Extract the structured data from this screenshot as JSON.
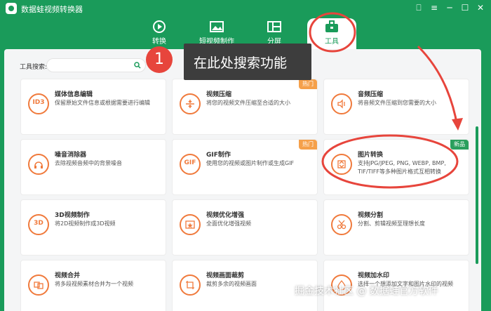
{
  "app": {
    "title": "数据蛙视频转换器"
  },
  "window_controls": {
    "feedback": "⎕",
    "menu": "≡",
    "minimize": "─",
    "maximize": "☐",
    "close": "✕"
  },
  "nav": [
    {
      "label": "转换",
      "icon": "convert-icon"
    },
    {
      "label": "短视频制作",
      "icon": "video-maker-icon"
    },
    {
      "label": "分屏",
      "icon": "split-screen-icon"
    },
    {
      "label": "工具",
      "icon": "toolbox-icon",
      "active": true
    }
  ],
  "search": {
    "label": "工具搜索:",
    "value": "",
    "placeholder": ""
  },
  "tools": [
    {
      "title": "媒体信息编辑",
      "desc": "保留原始文件信息或根据需要进行编辑",
      "icon_text": "ID3",
      "badge": ""
    },
    {
      "title": "视频压缩",
      "desc": "将您的视频文件压缩至合适的大小",
      "icon_text": "",
      "badge": "热门"
    },
    {
      "title": "音频压缩",
      "desc": "将音频文件压缩到您需要的大小",
      "icon_text": "",
      "badge": ""
    },
    {
      "title": "噪音消除器",
      "desc": "去除视频音频中的背景噪音",
      "icon_text": "",
      "badge": ""
    },
    {
      "title": "GIF制作",
      "desc": "使用您的视频或图片制作或生成GIF",
      "icon_text": "GIF",
      "badge": "热门"
    },
    {
      "title": "图片转换",
      "desc": "支持JPG/JPEG, PNG, WEBP, BMP, TIF/TIFF等多种图片格式互相转换",
      "icon_text": "",
      "badge": "新品"
    },
    {
      "title": "3D视频制作",
      "desc": "将2D视频制作成3D视频",
      "icon_text": "3D",
      "badge": ""
    },
    {
      "title": "视频优化增强",
      "desc": "全面优化增强视频",
      "icon_text": "",
      "badge": ""
    },
    {
      "title": "视频分割",
      "desc": "分割、剪辑视频至理想长度",
      "icon_text": "",
      "badge": ""
    },
    {
      "title": "视频合并",
      "desc": "将多段视频素材合并为一个视频",
      "icon_text": "",
      "badge": ""
    },
    {
      "title": "视频画面裁剪",
      "desc": "裁剪多余的视频画面",
      "icon_text": "",
      "badge": ""
    },
    {
      "title": "视频加水印",
      "desc": "选择一个想添加文字和图片水印的视频",
      "icon_text": "",
      "badge": ""
    }
  ],
  "annotation": {
    "number": "1",
    "text": "在此处搜索功能"
  },
  "watermark": "掘金技术社区 @ 数据蛙官方软件",
  "colors": {
    "primary": "#1a9b5a",
    "accent": "#f07a3c",
    "hot": "#f5a04a",
    "annotation": "#e7453c"
  }
}
